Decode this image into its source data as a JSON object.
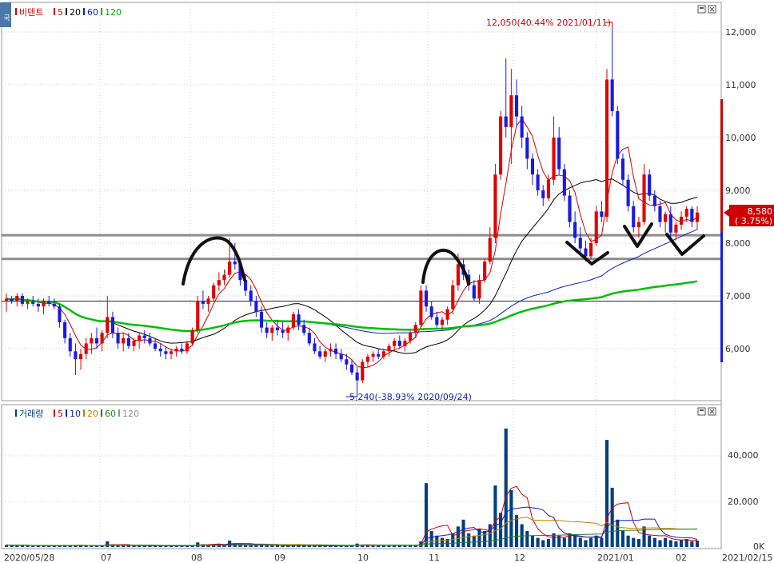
{
  "corner_label": "국",
  "price_pane": {
    "legend": [
      {
        "label": "비덴트",
        "color": "#d00000"
      },
      {
        "label": "5",
        "color": "#d00000"
      },
      {
        "label": "20",
        "color": "#000000"
      },
      {
        "label": "60",
        "color": "#1020c0"
      },
      {
        "label": "120",
        "color": "#00b000"
      }
    ],
    "y_ticks": [
      "12,000",
      "11,000",
      "10,000",
      "9,000",
      "8,000",
      "7,000",
      "6,000"
    ],
    "current_price": "8,580",
    "current_change": "( 3.75%)",
    "high_annotation": "12,050(40.44% 2021/01/11)",
    "low_annotation": "5,240(-38.93% 2020/09/24)"
  },
  "volume_pane": {
    "legend": [
      {
        "label": "거래량",
        "color": "#003f7f"
      },
      {
        "label": "5",
        "color": "#d00000"
      },
      {
        "label": "10",
        "color": "#1020c0"
      },
      {
        "label": "20",
        "color": "#c08000"
      },
      {
        "label": "60",
        "color": "#208020"
      },
      {
        "label": "120",
        "color": "#909090"
      }
    ],
    "y_ticks": [
      "40,000",
      "20,000",
      "0K"
    ]
  },
  "x_ticks": [
    "2020/05/28",
    "07",
    "08",
    "09",
    "10",
    "11",
    "12",
    "2021/01",
    "02",
    "2021/02/15"
  ],
  "chart_data": {
    "type": "candlestick",
    "ylim": [
      5000,
      12500
    ],
    "volume_ylim": [
      0,
      57000
    ],
    "reference_lines": [
      8150,
      7700,
      6900
    ],
    "candles": [
      [
        6900,
        7050,
        6700,
        6950
      ],
      [
        6950,
        7000,
        6850,
        6900
      ],
      [
        6900,
        7050,
        6800,
        7000
      ],
      [
        7000,
        7050,
        6800,
        6850
      ],
      [
        6850,
        6950,
        6750,
        6900
      ],
      [
        6900,
        7000,
        6800,
        6850
      ],
      [
        6850,
        6950,
        6700,
        6800
      ],
      [
        6800,
        6950,
        6650,
        6900
      ],
      [
        6900,
        7000,
        6800,
        6850
      ],
      [
        6850,
        6950,
        6750,
        6800
      ],
      [
        6800,
        6850,
        6400,
        6500
      ],
      [
        6500,
        6550,
        6100,
        6200
      ],
      [
        6200,
        6300,
        5850,
        5950
      ],
      [
        5950,
        6100,
        5500,
        5800
      ],
      [
        5800,
        6000,
        5600,
        5900
      ],
      [
        5900,
        6200,
        5800,
        6100
      ],
      [
        6100,
        6300,
        5900,
        6200
      ],
      [
        6200,
        6400,
        6000,
        6100
      ],
      [
        6100,
        6350,
        5950,
        6300
      ],
      [
        6300,
        7000,
        6200,
        6600
      ],
      [
        6600,
        6700,
        6200,
        6300
      ],
      [
        6300,
        6400,
        6000,
        6100
      ],
      [
        6100,
        6300,
        5950,
        6200
      ],
      [
        6200,
        6300,
        6000,
        6050
      ],
      [
        6050,
        6200,
        5950,
        6150
      ],
      [
        6150,
        6300,
        6000,
        6250
      ],
      [
        6250,
        6350,
        6100,
        6200
      ],
      [
        6200,
        6300,
        6050,
        6100
      ],
      [
        6100,
        6200,
        5950,
        6000
      ],
      [
        6000,
        6100,
        5850,
        5950
      ],
      [
        5950,
        6050,
        5800,
        5900
      ],
      [
        5900,
        6000,
        5800,
        5950
      ],
      [
        5950,
        6050,
        5850,
        6000
      ],
      [
        6000,
        6100,
        5900,
        5950
      ],
      [
        5950,
        6150,
        5900,
        6100
      ],
      [
        6100,
        6400,
        6050,
        6350
      ],
      [
        6350,
        7000,
        6300,
        6900
      ],
      [
        6900,
        7100,
        6750,
        6850
      ],
      [
        6850,
        7000,
        6700,
        6950
      ],
      [
        6950,
        7250,
        6900,
        7200
      ],
      [
        7200,
        7450,
        7100,
        7300
      ],
      [
        7300,
        7500,
        7200,
        7400
      ],
      [
        7400,
        8100,
        7350,
        7650
      ],
      [
        7650,
        8000,
        7500,
        7600
      ],
      [
        7600,
        7700,
        7200,
        7300
      ],
      [
        7300,
        7400,
        7000,
        7100
      ],
      [
        7100,
        7200,
        6800,
        6900
      ],
      [
        6900,
        7000,
        6600,
        6700
      ],
      [
        6700,
        6800,
        6300,
        6400
      ],
      [
        6400,
        6500,
        6200,
        6300
      ],
      [
        6300,
        6450,
        6150,
        6400
      ],
      [
        6400,
        6550,
        6250,
        6350
      ],
      [
        6350,
        6500,
        6200,
        6300
      ],
      [
        6300,
        6450,
        6150,
        6400
      ],
      [
        6400,
        6700,
        6350,
        6650
      ],
      [
        6650,
        6750,
        6350,
        6450
      ],
      [
        6450,
        6550,
        6250,
        6300
      ],
      [
        6300,
        6400,
        6050,
        6100
      ],
      [
        6100,
        6200,
        5900,
        5950
      ],
      [
        5950,
        6050,
        5800,
        5850
      ],
      [
        5850,
        6000,
        5750,
        5950
      ],
      [
        5950,
        6100,
        5850,
        6000
      ],
      [
        6000,
        6100,
        5800,
        5900
      ],
      [
        5900,
        6000,
        5750,
        5800
      ],
      [
        5800,
        5900,
        5600,
        5700
      ],
      [
        5700,
        5800,
        5500,
        5550
      ],
      [
        5550,
        5650,
        5240,
        5400
      ],
      [
        5400,
        5800,
        5350,
        5750
      ],
      [
        5750,
        5900,
        5650,
        5850
      ],
      [
        5850,
        5950,
        5750,
        5900
      ],
      [
        5900,
        6000,
        5800,
        5850
      ],
      [
        5850,
        6000,
        5800,
        5950
      ],
      [
        5950,
        6100,
        5850,
        6050
      ],
      [
        6050,
        6200,
        5950,
        6150
      ],
      [
        6150,
        6250,
        6000,
        6050
      ],
      [
        6050,
        6200,
        5950,
        6150
      ],
      [
        6150,
        6350,
        6100,
        6300
      ],
      [
        6300,
        6500,
        6200,
        6450
      ],
      [
        6450,
        7200,
        6400,
        7100
      ],
      [
        7100,
        7200,
        6700,
        6800
      ],
      [
        6800,
        6900,
        6550,
        6600
      ],
      [
        6600,
        6700,
        6400,
        6450
      ],
      [
        6450,
        6600,
        6350,
        6550
      ],
      [
        6550,
        6800,
        6450,
        6750
      ],
      [
        6750,
        7300,
        6650,
        7200
      ],
      [
        7200,
        7800,
        7100,
        7600
      ],
      [
        7600,
        7700,
        7300,
        7400
      ],
      [
        7400,
        7500,
        7100,
        7200
      ],
      [
        7200,
        7300,
        6900,
        6950
      ],
      [
        6950,
        7400,
        6850,
        7300
      ],
      [
        7300,
        7700,
        7250,
        7650
      ],
      [
        7650,
        8300,
        7600,
        8100
      ],
      [
        8100,
        9500,
        8000,
        9300
      ],
      [
        9300,
        10500,
        9200,
        10400
      ],
      [
        10400,
        11500,
        10000,
        10200
      ],
      [
        10200,
        11300,
        9500,
        10800
      ],
      [
        10800,
        11100,
        10200,
        10400
      ],
      [
        10400,
        10600,
        9800,
        10000
      ],
      [
        10000,
        10100,
        9400,
        9600
      ],
      [
        9600,
        9700,
        9100,
        9300
      ],
      [
        9300,
        9400,
        8900,
        9000
      ],
      [
        9000,
        9100,
        8700,
        8850
      ],
      [
        8850,
        9300,
        8800,
        9200
      ],
      [
        9200,
        10400,
        9100,
        10000
      ],
      [
        10000,
        10200,
        9300,
        9400
      ],
      [
        9400,
        9500,
        8800,
        8900
      ],
      [
        8900,
        9000,
        8300,
        8400
      ],
      [
        8400,
        8600,
        8000,
        8100
      ],
      [
        8100,
        8300,
        7800,
        7900
      ],
      [
        7900,
        8050,
        7650,
        7750
      ],
      [
        7750,
        8100,
        7700,
        8000
      ],
      [
        8000,
        8700,
        7950,
        8600
      ],
      [
        8600,
        8800,
        8400,
        8500
      ],
      [
        8500,
        11300,
        8400,
        11100
      ],
      [
        11100,
        12050,
        10400,
        10500
      ],
      [
        10500,
        10600,
        9500,
        9600
      ],
      [
        9600,
        9700,
        9100,
        9200
      ],
      [
        9200,
        9300,
        8600,
        8700
      ],
      [
        8700,
        8800,
        8200,
        8300
      ],
      [
        8300,
        8500,
        8100,
        8400
      ],
      [
        8400,
        9500,
        8350,
        9300
      ],
      [
        9300,
        9400,
        8800,
        8900
      ],
      [
        8900,
        9000,
        8600,
        8700
      ],
      [
        8700,
        8800,
        8300,
        8400
      ],
      [
        8400,
        8600,
        8200,
        8550
      ],
      [
        8550,
        8700,
        8100,
        8200
      ],
      [
        8200,
        8400,
        8050,
        8350
      ],
      [
        8350,
        8600,
        8250,
        8500
      ],
      [
        8500,
        8700,
        8400,
        8650
      ],
      [
        8650,
        8700,
        8300,
        8400
      ],
      [
        8400,
        8700,
        8250,
        8580
      ]
    ],
    "volumes": [
      900,
      700,
      800,
      700,
      600,
      500,
      600,
      700,
      600,
      500,
      800,
      900,
      700,
      800,
      600,
      700,
      600,
      500,
      600,
      2500,
      800,
      600,
      700,
      600,
      500,
      600,
      500,
      600,
      500,
      700,
      500,
      600,
      500,
      600,
      500,
      700,
      2000,
      1200,
      900,
      1100,
      1300,
      1000,
      2800,
      1500,
      1200,
      1000,
      900,
      1000,
      800,
      700,
      600,
      700,
      600,
      500,
      900,
      800,
      700,
      600,
      500,
      600,
      500,
      600,
      500,
      600,
      700,
      800,
      1500,
      900,
      800,
      600,
      600,
      700,
      800,
      700,
      600,
      700,
      800,
      900,
      2500,
      28000,
      7000,
      5000,
      4000,
      3500,
      6000,
      9000,
      12000,
      6000,
      5000,
      8000,
      7000,
      10000,
      27000,
      15000,
      52000,
      25000,
      14000,
      10000,
      7000,
      5000,
      4000,
      3000,
      3500,
      6000,
      5000,
      4000,
      6000,
      5000,
      4000,
      3000,
      4000,
      5000,
      4000,
      47000,
      26000,
      12000,
      7000,
      5000,
      4000,
      3500,
      9000,
      5000,
      4000,
      3000,
      4000,
      3000,
      2500,
      3000,
      3500,
      2500,
      2800
    ]
  }
}
